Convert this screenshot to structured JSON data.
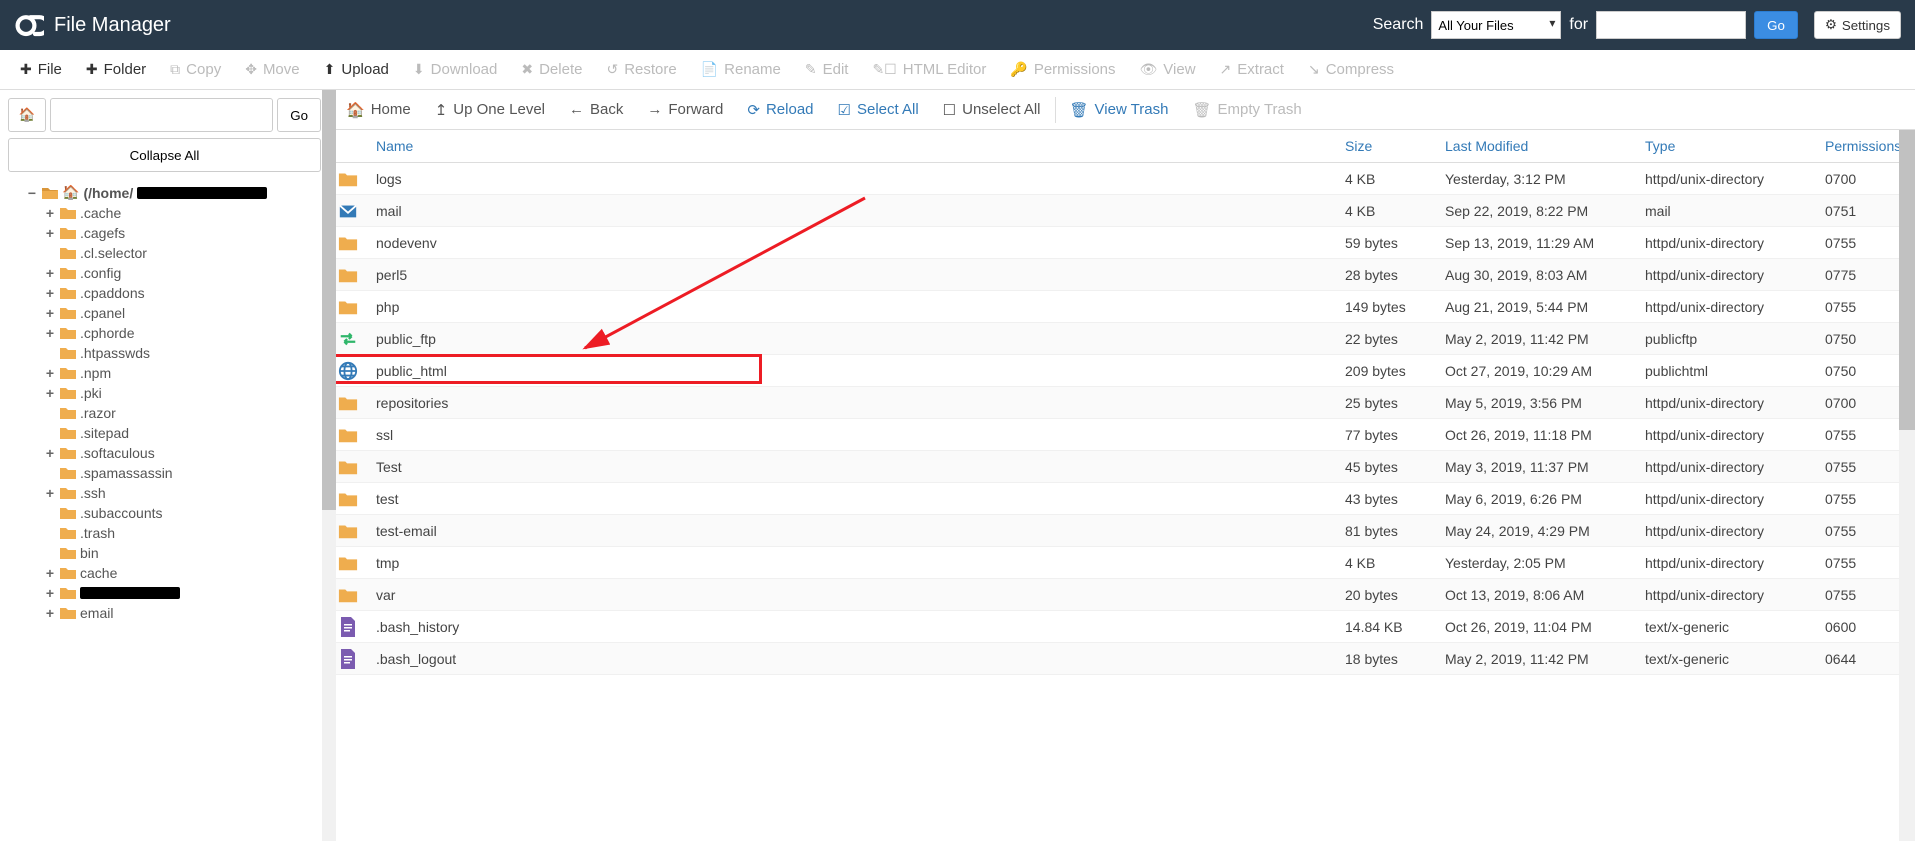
{
  "header": {
    "title": "File Manager",
    "search_label": "Search",
    "search_scope": "All Your Files",
    "for_label": "for",
    "go_label": "Go",
    "settings_label": "Settings"
  },
  "toolbar": [
    {
      "icon": "plus",
      "label": "File",
      "enabled": true
    },
    {
      "icon": "plus",
      "label": "Folder",
      "enabled": true
    },
    {
      "icon": "copy",
      "label": "Copy",
      "enabled": false
    },
    {
      "icon": "move",
      "label": "Move",
      "enabled": false
    },
    {
      "icon": "upload",
      "label": "Upload",
      "enabled": true
    },
    {
      "icon": "download",
      "label": "Download",
      "enabled": false
    },
    {
      "icon": "delete",
      "label": "Delete",
      "enabled": false
    },
    {
      "icon": "restore",
      "label": "Restore",
      "enabled": false
    },
    {
      "icon": "rename",
      "label": "Rename",
      "enabled": false
    },
    {
      "icon": "edit",
      "label": "Edit",
      "enabled": false
    },
    {
      "icon": "htmledit",
      "label": "HTML Editor",
      "enabled": false
    },
    {
      "icon": "perms",
      "label": "Permissions",
      "enabled": false
    },
    {
      "icon": "view",
      "label": "View",
      "enabled": false
    },
    {
      "icon": "extract",
      "label": "Extract",
      "enabled": false
    },
    {
      "icon": "compress",
      "label": "Compress",
      "enabled": false
    }
  ],
  "nav": {
    "path_value": "",
    "go_label": "Go",
    "collapse_label": "Collapse All"
  },
  "tree_root": {
    "label_prefix": "(/home/",
    "redact_width": 130
  },
  "tree": [
    {
      "toggle": "+",
      "label": ".cache"
    },
    {
      "toggle": "+",
      "label": ".cagefs"
    },
    {
      "toggle": "",
      "label": ".cl.selector"
    },
    {
      "toggle": "+",
      "label": ".config"
    },
    {
      "toggle": "+",
      "label": ".cpaddons"
    },
    {
      "toggle": "+",
      "label": ".cpanel"
    },
    {
      "toggle": "+",
      "label": ".cphorde"
    },
    {
      "toggle": "",
      "label": ".htpasswds"
    },
    {
      "toggle": "+",
      "label": ".npm"
    },
    {
      "toggle": "+",
      "label": ".pki"
    },
    {
      "toggle": "",
      "label": ".razor"
    },
    {
      "toggle": "",
      "label": ".sitepad"
    },
    {
      "toggle": "+",
      "label": ".softaculous"
    },
    {
      "toggle": "",
      "label": ".spamassassin"
    },
    {
      "toggle": "+",
      "label": ".ssh"
    },
    {
      "toggle": "",
      "label": ".subaccounts"
    },
    {
      "toggle": "",
      "label": ".trash"
    },
    {
      "toggle": "",
      "label": "bin"
    },
    {
      "toggle": "+",
      "label": "cache"
    },
    {
      "toggle": "+",
      "label": "",
      "redact": true,
      "redact_width": 100
    },
    {
      "toggle": "+",
      "label": "email"
    }
  ],
  "path_toolbar": {
    "home": "Home",
    "up": "Up One Level",
    "back": "Back",
    "forward": "Forward",
    "reload": "Reload",
    "select_all": "Select All",
    "unselect_all": "Unselect All",
    "view_trash": "View Trash",
    "empty_trash": "Empty Trash"
  },
  "columns": {
    "name": "Name",
    "size": "Size",
    "modified": "Last Modified",
    "type": "Type",
    "perms": "Permissions"
  },
  "files": [
    {
      "icon": "folder",
      "name": "logs",
      "size": "4 KB",
      "modified": "Yesterday, 3:12 PM",
      "type": "httpd/unix-directory",
      "perms": "0700"
    },
    {
      "icon": "mail",
      "name": "mail",
      "size": "4 KB",
      "modified": "Sep 22, 2019, 8:22 PM",
      "type": "mail",
      "perms": "0751"
    },
    {
      "icon": "folder",
      "name": "nodevenv",
      "size": "59 bytes",
      "modified": "Sep 13, 2019, 11:29 AM",
      "type": "httpd/unix-directory",
      "perms": "0755"
    },
    {
      "icon": "folder",
      "name": "perl5",
      "size": "28 bytes",
      "modified": "Aug 30, 2019, 8:03 AM",
      "type": "httpd/unix-directory",
      "perms": "0775"
    },
    {
      "icon": "folder",
      "name": "php",
      "size": "149 bytes",
      "modified": "Aug 21, 2019, 5:44 PM",
      "type": "httpd/unix-directory",
      "perms": "0755"
    },
    {
      "icon": "ftp",
      "name": "public_ftp",
      "size": "22 bytes",
      "modified": "May 2, 2019, 11:42 PM",
      "type": "publicftp",
      "perms": "0750"
    },
    {
      "icon": "globe",
      "name": "public_html",
      "size": "209 bytes",
      "modified": "Oct 27, 2019, 10:29 AM",
      "type": "publichtml",
      "perms": "0750",
      "highlight": true
    },
    {
      "icon": "folder",
      "name": "repositories",
      "size": "25 bytes",
      "modified": "May 5, 2019, 3:56 PM",
      "type": "httpd/unix-directory",
      "perms": "0700"
    },
    {
      "icon": "folder",
      "name": "ssl",
      "size": "77 bytes",
      "modified": "Oct 26, 2019, 11:18 PM",
      "type": "httpd/unix-directory",
      "perms": "0755"
    },
    {
      "icon": "folder",
      "name": "Test",
      "size": "45 bytes",
      "modified": "May 3, 2019, 11:37 PM",
      "type": "httpd/unix-directory",
      "perms": "0755"
    },
    {
      "icon": "folder",
      "name": "test",
      "size": "43 bytes",
      "modified": "May 6, 2019, 6:26 PM",
      "type": "httpd/unix-directory",
      "perms": "0755"
    },
    {
      "icon": "folder",
      "name": "test-email",
      "size": "81 bytes",
      "modified": "May 24, 2019, 4:29 PM",
      "type": "httpd/unix-directory",
      "perms": "0755"
    },
    {
      "icon": "folder",
      "name": "tmp",
      "size": "4 KB",
      "modified": "Yesterday, 2:05 PM",
      "type": "httpd/unix-directory",
      "perms": "0755"
    },
    {
      "icon": "folder",
      "name": "var",
      "size": "20 bytes",
      "modified": "Oct 13, 2019, 8:06 AM",
      "type": "httpd/unix-directory",
      "perms": "0755"
    },
    {
      "icon": "file",
      "name": ".bash_history",
      "size": "14.84 KB",
      "modified": "Oct 26, 2019, 11:04 PM",
      "type": "text/x-generic",
      "perms": "0600"
    },
    {
      "icon": "file",
      "name": ".bash_logout",
      "size": "18 bytes",
      "modified": "May 2, 2019, 11:42 PM",
      "type": "text/x-generic",
      "perms": "0644"
    }
  ]
}
